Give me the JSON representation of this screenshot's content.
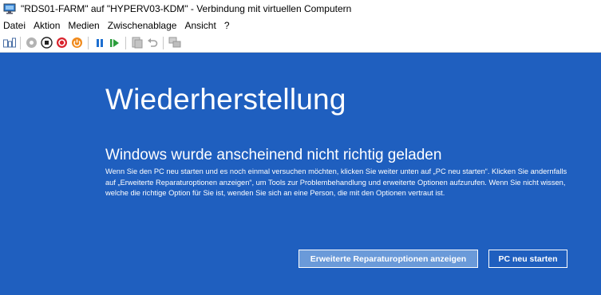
{
  "window": {
    "title": "\"RDS01-FARM\" auf \"HYPERV03-KDM\" - Verbindung mit virtuellen Computern",
    "icon": "vm-connection-icon"
  },
  "menu": {
    "items": [
      "Datei",
      "Aktion",
      "Medien",
      "Zwischenablage",
      "Ansicht",
      "?"
    ]
  },
  "toolbar": {
    "icons": [
      "ctrl-alt-del-icon",
      "start-icon",
      "turn-off-icon",
      "shut-down-icon",
      "power-icon",
      "pause-icon",
      "resume-icon",
      "checkpoint-icon",
      "revert-icon",
      "enhanced-session-icon"
    ]
  },
  "screen": {
    "heading": "Wiederherstellung",
    "subheading": "Windows wurde anscheinend nicht richtig geladen",
    "body": "Wenn Sie den PC neu starten und es noch einmal versuchen möchten, klicken Sie weiter unten auf „PC neu starten“. Klicken Sie andernfalls auf „Erweiterte Reparaturoptionen anzeigen“, um Tools zur Problembehandlung und erweiterte Optionen aufzurufen. Wenn Sie nicht wissen, welche die richtige Option für Sie ist, wenden Sie sich an eine Person, die mit den Optionen vertraut ist.",
    "advanced_button": "Erweiterte Reparaturoptionen anzeigen",
    "restart_button": "PC neu starten"
  },
  "colors": {
    "recovery_background": "#1f5fbf",
    "advanced_button_fill": "#6a9ad9"
  }
}
